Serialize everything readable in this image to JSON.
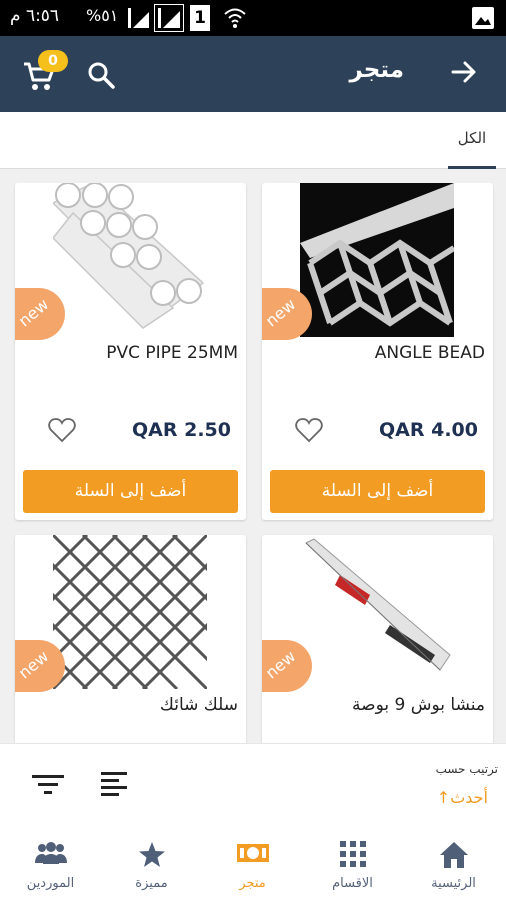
{
  "status_bar": {
    "time": "٦:٥٦ م",
    "battery": "%٥١",
    "sim_number": "1"
  },
  "app_bar": {
    "title": "متجر",
    "cart_count": "0"
  },
  "tabs": [
    {
      "label": "الكل",
      "active": true
    }
  ],
  "products": [
    {
      "name": "ANGLE BEAD",
      "price": "QAR 4.00",
      "badge": "new",
      "add_label": "أضف إلى السلة",
      "image": "angle-bead-photo"
    },
    {
      "name": "PVC PIPE 25MM",
      "price": "QAR 2.50",
      "badge": "new",
      "add_label": "أضف إلى السلة",
      "image": "pvc-pipe-photo"
    },
    {
      "name": "منشا بوش 9 بوصة",
      "badge": "new",
      "image": "saw-blade-photo"
    },
    {
      "name": "سلك شائك",
      "badge": "new",
      "image": "wire-mesh-photo"
    }
  ],
  "sort": {
    "label": "ترتيب حسب",
    "value": "أحدث"
  },
  "bottom_nav": [
    {
      "label": "الرئيسية",
      "icon": "home-icon",
      "active": false
    },
    {
      "label": "الاقسام",
      "icon": "grid-icon",
      "active": false
    },
    {
      "label": "متجر",
      "icon": "money-icon",
      "active": true
    },
    {
      "label": "مميزة",
      "icon": "star-icon",
      "active": false
    },
    {
      "label": "الموردين",
      "icon": "group-icon",
      "active": false
    }
  ],
  "colors": {
    "app_bar": "#2d4258",
    "accent": "#f29c24",
    "badge": "#f5bf1c",
    "new_badge": "#f4a56a",
    "price": "#1e3152"
  }
}
